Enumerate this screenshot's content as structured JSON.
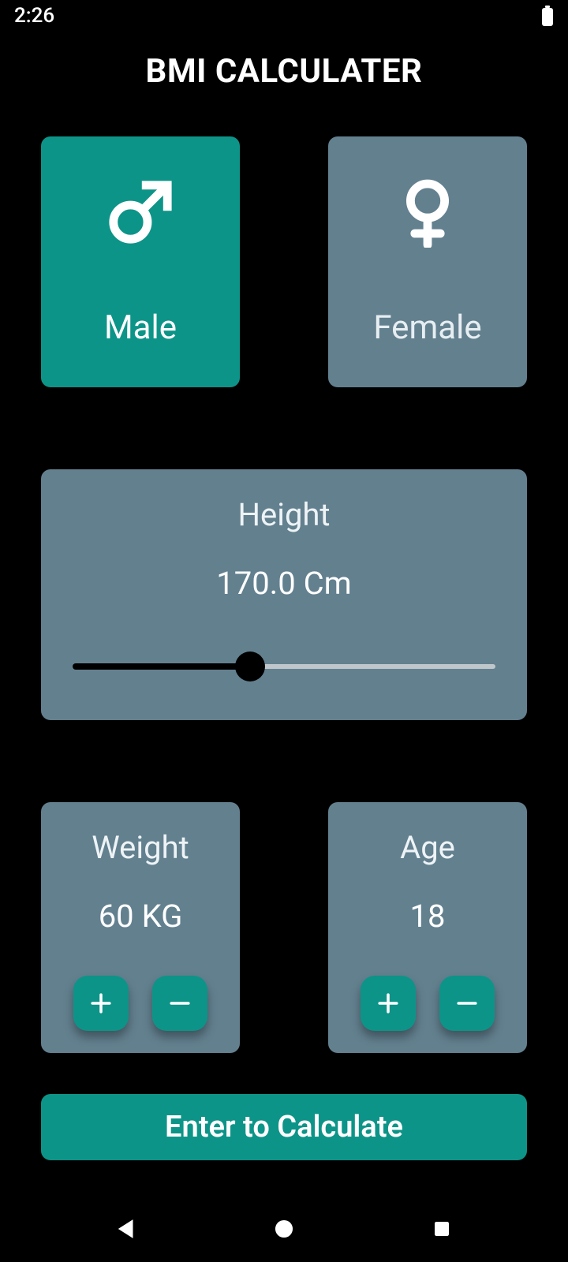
{
  "status": {
    "time": "2:26"
  },
  "title": "BMI CALCULATER",
  "gender": {
    "male": {
      "label": "Male",
      "selected": true
    },
    "female": {
      "label": "Female",
      "selected": false
    }
  },
  "height": {
    "title": "Height",
    "value_text": "170.0 Cm",
    "value": 170.0,
    "min": 100,
    "max": 270,
    "slider_percent": 42
  },
  "weight": {
    "title": "Weight",
    "value_text": "60 KG",
    "value": 60
  },
  "age": {
    "title": "Age",
    "value_text": "18",
    "value": 18
  },
  "calculate_label": "Enter to Calculate",
  "colors": {
    "accent": "#0d9488",
    "card_inactive": "#63808f",
    "background": "#000000"
  }
}
